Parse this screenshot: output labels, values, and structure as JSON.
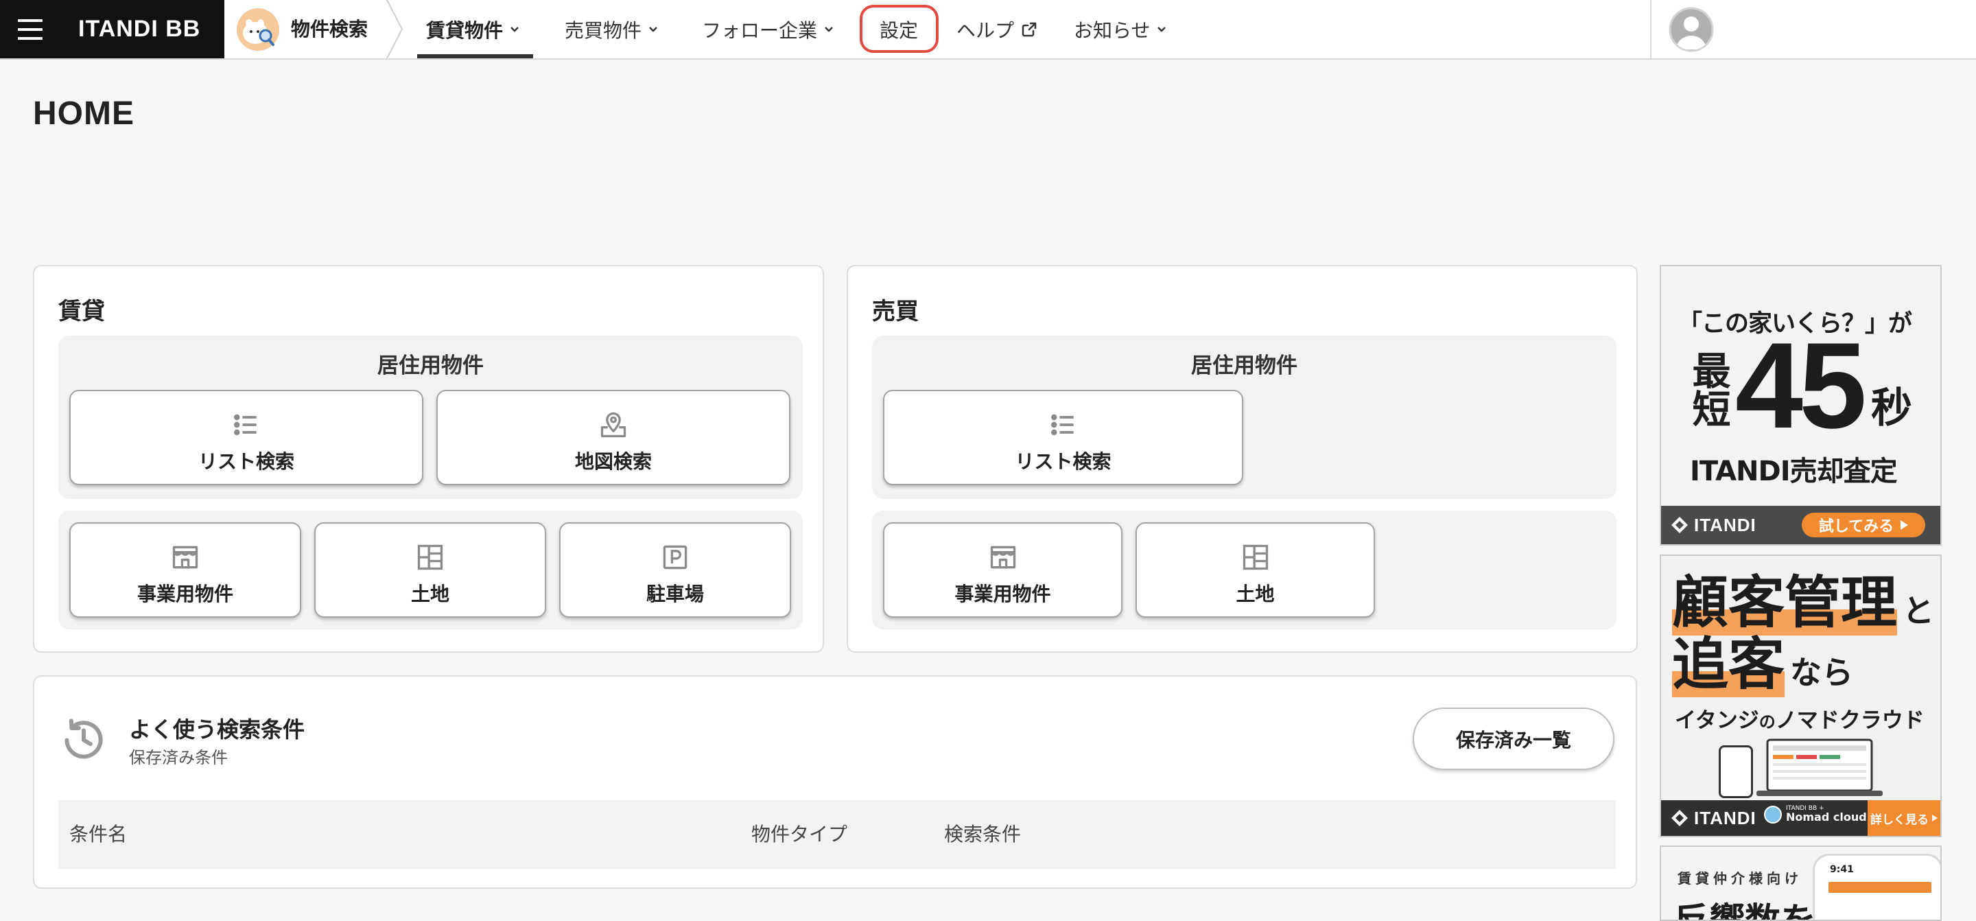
{
  "colors": {
    "page_bg": "#f7f7f9",
    "nav_active": "#333333",
    "highlight_outline": "#e34a3f",
    "panel_bg": "#f2f2f4",
    "icon_gray": "#8a8a8a",
    "ad_orange": "#f28a30"
  },
  "nav": {
    "logo": "ITANDI BB",
    "app_name": "物件検索",
    "icons": {
      "menu": "hamburger-icon",
      "app": "mascot-icon",
      "user": "user-avatar-icon"
    },
    "menu": [
      {
        "label": "賃貸物件",
        "active": true,
        "has_dropdown": true
      },
      {
        "label": "売買物件",
        "active": false,
        "has_dropdown": true
      },
      {
        "label": "フォロー企業",
        "active": false,
        "has_dropdown": true
      },
      {
        "label": "設定",
        "active": false,
        "has_dropdown": false,
        "highlighted": true
      },
      {
        "label": "ヘルプ",
        "active": false,
        "has_dropdown": false,
        "external": true
      },
      {
        "label": "お知らせ",
        "active": false,
        "has_dropdown": true
      }
    ]
  },
  "page": {
    "title": "HOME"
  },
  "rent": {
    "title": "賃貸",
    "residential": {
      "heading": "居住用物件",
      "buttons": [
        {
          "label": "リスト検索",
          "icon": "list-icon"
        },
        {
          "label": "地図検索",
          "icon": "map-pin-icon"
        }
      ]
    },
    "other": {
      "buttons": [
        {
          "label": "事業用物件",
          "icon": "store-icon"
        },
        {
          "label": "土地",
          "icon": "land-icon"
        },
        {
          "label": "駐車場",
          "icon": "parking-icon"
        }
      ]
    }
  },
  "sale": {
    "title": "売買",
    "residential": {
      "heading": "居住用物件",
      "buttons": [
        {
          "label": "リスト検索",
          "icon": "list-icon"
        }
      ]
    },
    "other": {
      "buttons": [
        {
          "label": "事業用物件",
          "icon": "store-icon"
        },
        {
          "label": "土地",
          "icon": "land-icon"
        }
      ]
    }
  },
  "saved_searches": {
    "icon": "history-icon",
    "title": "よく使う検索条件",
    "subtitle": "保存済み条件",
    "list_button": "保存済み一覧",
    "columns": [
      "条件名",
      "物件タイプ",
      "検索条件"
    ],
    "rows": []
  },
  "ads": [
    {
      "quote": "「この家いくら？」が",
      "lead": "最短",
      "number": "45",
      "unit": "秒",
      "product": "ITANDI売却査定",
      "brand": "ITANDI",
      "cta": "試してみる"
    },
    {
      "headline_1": "顧客管理",
      "headline_1_suffix": "と",
      "headline_2": "追客",
      "headline_2_suffix": "なら",
      "tagline_a": "イタンジ",
      "tagline_b": "の",
      "tagline_c": "ノマドクラウド",
      "brand": "ITANDI",
      "partner_top": "ITANDI BB +",
      "partner_name": "Nomad cloud",
      "cta": "詳しく見る"
    },
    {
      "eyebrow": "賃貸仲介様向け",
      "headline": "反響数を",
      "phone_time": "9:41"
    }
  ]
}
